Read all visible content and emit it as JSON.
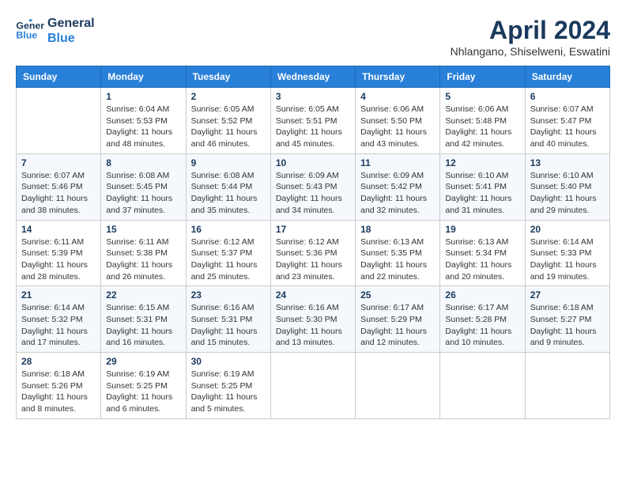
{
  "logo": {
    "line1": "General",
    "line2": "Blue"
  },
  "title": "April 2024",
  "subtitle": "Nhlangano, Shiselweni, Eswatini",
  "days_of_week": [
    "Sunday",
    "Monday",
    "Tuesday",
    "Wednesday",
    "Thursday",
    "Friday",
    "Saturday"
  ],
  "weeks": [
    [
      {
        "day": "",
        "info": ""
      },
      {
        "day": "1",
        "info": "Sunrise: 6:04 AM\nSunset: 5:53 PM\nDaylight: 11 hours\nand 48 minutes."
      },
      {
        "day": "2",
        "info": "Sunrise: 6:05 AM\nSunset: 5:52 PM\nDaylight: 11 hours\nand 46 minutes."
      },
      {
        "day": "3",
        "info": "Sunrise: 6:05 AM\nSunset: 5:51 PM\nDaylight: 11 hours\nand 45 minutes."
      },
      {
        "day": "4",
        "info": "Sunrise: 6:06 AM\nSunset: 5:50 PM\nDaylight: 11 hours\nand 43 minutes."
      },
      {
        "day": "5",
        "info": "Sunrise: 6:06 AM\nSunset: 5:48 PM\nDaylight: 11 hours\nand 42 minutes."
      },
      {
        "day": "6",
        "info": "Sunrise: 6:07 AM\nSunset: 5:47 PM\nDaylight: 11 hours\nand 40 minutes."
      }
    ],
    [
      {
        "day": "7",
        "info": "Sunrise: 6:07 AM\nSunset: 5:46 PM\nDaylight: 11 hours\nand 38 minutes."
      },
      {
        "day": "8",
        "info": "Sunrise: 6:08 AM\nSunset: 5:45 PM\nDaylight: 11 hours\nand 37 minutes."
      },
      {
        "day": "9",
        "info": "Sunrise: 6:08 AM\nSunset: 5:44 PM\nDaylight: 11 hours\nand 35 minutes."
      },
      {
        "day": "10",
        "info": "Sunrise: 6:09 AM\nSunset: 5:43 PM\nDaylight: 11 hours\nand 34 minutes."
      },
      {
        "day": "11",
        "info": "Sunrise: 6:09 AM\nSunset: 5:42 PM\nDaylight: 11 hours\nand 32 minutes."
      },
      {
        "day": "12",
        "info": "Sunrise: 6:10 AM\nSunset: 5:41 PM\nDaylight: 11 hours\nand 31 minutes."
      },
      {
        "day": "13",
        "info": "Sunrise: 6:10 AM\nSunset: 5:40 PM\nDaylight: 11 hours\nand 29 minutes."
      }
    ],
    [
      {
        "day": "14",
        "info": "Sunrise: 6:11 AM\nSunset: 5:39 PM\nDaylight: 11 hours\nand 28 minutes."
      },
      {
        "day": "15",
        "info": "Sunrise: 6:11 AM\nSunset: 5:38 PM\nDaylight: 11 hours\nand 26 minutes."
      },
      {
        "day": "16",
        "info": "Sunrise: 6:12 AM\nSunset: 5:37 PM\nDaylight: 11 hours\nand 25 minutes."
      },
      {
        "day": "17",
        "info": "Sunrise: 6:12 AM\nSunset: 5:36 PM\nDaylight: 11 hours\nand 23 minutes."
      },
      {
        "day": "18",
        "info": "Sunrise: 6:13 AM\nSunset: 5:35 PM\nDaylight: 11 hours\nand 22 minutes."
      },
      {
        "day": "19",
        "info": "Sunrise: 6:13 AM\nSunset: 5:34 PM\nDaylight: 11 hours\nand 20 minutes."
      },
      {
        "day": "20",
        "info": "Sunrise: 6:14 AM\nSunset: 5:33 PM\nDaylight: 11 hours\nand 19 minutes."
      }
    ],
    [
      {
        "day": "21",
        "info": "Sunrise: 6:14 AM\nSunset: 5:32 PM\nDaylight: 11 hours\nand 17 minutes."
      },
      {
        "day": "22",
        "info": "Sunrise: 6:15 AM\nSunset: 5:31 PM\nDaylight: 11 hours\nand 16 minutes."
      },
      {
        "day": "23",
        "info": "Sunrise: 6:16 AM\nSunset: 5:31 PM\nDaylight: 11 hours\nand 15 minutes."
      },
      {
        "day": "24",
        "info": "Sunrise: 6:16 AM\nSunset: 5:30 PM\nDaylight: 11 hours\nand 13 minutes."
      },
      {
        "day": "25",
        "info": "Sunrise: 6:17 AM\nSunset: 5:29 PM\nDaylight: 11 hours\nand 12 minutes."
      },
      {
        "day": "26",
        "info": "Sunrise: 6:17 AM\nSunset: 5:28 PM\nDaylight: 11 hours\nand 10 minutes."
      },
      {
        "day": "27",
        "info": "Sunrise: 6:18 AM\nSunset: 5:27 PM\nDaylight: 11 hours\nand 9 minutes."
      }
    ],
    [
      {
        "day": "28",
        "info": "Sunrise: 6:18 AM\nSunset: 5:26 PM\nDaylight: 11 hours\nand 8 minutes."
      },
      {
        "day": "29",
        "info": "Sunrise: 6:19 AM\nSunset: 5:25 PM\nDaylight: 11 hours\nand 6 minutes."
      },
      {
        "day": "30",
        "info": "Sunrise: 6:19 AM\nSunset: 5:25 PM\nDaylight: 11 hours\nand 5 minutes."
      },
      {
        "day": "",
        "info": ""
      },
      {
        "day": "",
        "info": ""
      },
      {
        "day": "",
        "info": ""
      },
      {
        "day": "",
        "info": ""
      }
    ]
  ]
}
